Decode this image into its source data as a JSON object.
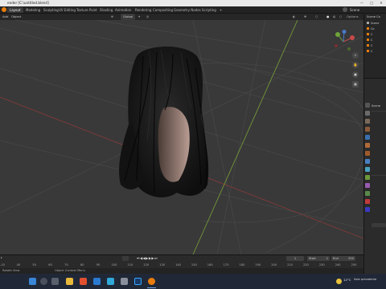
{
  "window": {
    "title": "ender [C:\\untitled.blend]",
    "minimize": "—",
    "maximize": "□",
    "close": "✕"
  },
  "workspaces": [
    {
      "label": "Layout",
      "active": true
    },
    {
      "label": "Modeling"
    },
    {
      "label": "Sculpting"
    },
    {
      "label": "UV Editing"
    },
    {
      "label": "Texture Paint"
    },
    {
      "label": "Shading"
    },
    {
      "label": "Animation"
    },
    {
      "label": "Rendering"
    },
    {
      "label": "Compositing"
    },
    {
      "label": "Geometry Nodes"
    },
    {
      "label": "Scripting"
    },
    {
      "label": "+"
    }
  ],
  "scene_field": "Scene",
  "header": {
    "add": "Add",
    "object": "Object",
    "orientation": "Global",
    "options": "Options"
  },
  "outliner": {
    "title": "Scene Co",
    "rows": [
      "Scene",
      "Co",
      "C",
      "C",
      "C",
      "C"
    ]
  },
  "props_header": "Scene",
  "timeline": {
    "ticks": [
      "-10",
      "40",
      "50",
      "60",
      "70",
      "80",
      "90",
      "100",
      "110",
      "120",
      "130",
      "140",
      "150",
      "160",
      "170",
      "180",
      "190",
      "200",
      "210",
      "220",
      "230",
      "240",
      "250"
    ],
    "current_frame": "1",
    "start_label": "Start",
    "start": "1",
    "end_label": "End",
    "end": "250"
  },
  "status": {
    "left": "Rotate View",
    "right": "Object Context Menu"
  },
  "taskbar": {
    "icons": [
      "windows-start-icon",
      "search-icon",
      "task-view-icon",
      "file-explorer-icon",
      "edge-browser-icon",
      "mail-icon",
      "photos-icon",
      "settings-icon",
      "photoshop-icon",
      "blender-icon"
    ],
    "weather": "12°C",
    "weather_text": "Sole prevalente"
  },
  "colors": {
    "accent": "#3a6fb0",
    "viewport": "#393939",
    "grid": "#4a4a4a",
    "x_axis": "#8a3a3a",
    "y_axis": "#7aa23a"
  }
}
